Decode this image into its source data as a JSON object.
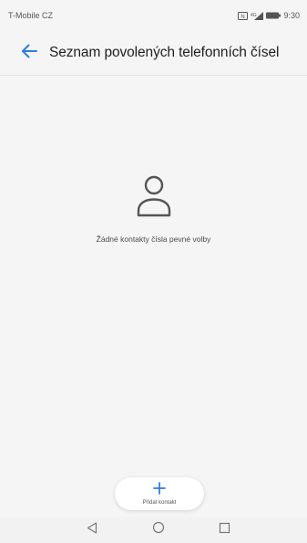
{
  "status_bar": {
    "carrier": "T-Mobile CZ",
    "time": "9:30",
    "icons": [
      "nfc-icon",
      "signal-icon",
      "battery-icon"
    ]
  },
  "app_bar": {
    "back_icon": "back-arrow-icon",
    "title": "Seznam povolených telefonních čísel"
  },
  "empty_state": {
    "icon": "person-icon",
    "message": "Žádné kontakty čísla pevné volby"
  },
  "add_contact": {
    "icon": "plus-icon",
    "label": "Přidat kontakt"
  },
  "nav_bar": {
    "buttons": [
      "back-triangle-icon",
      "home-circle-icon",
      "recents-square-icon"
    ]
  },
  "colors": {
    "accent": "#2f7de0",
    "background": "#f5f5f5",
    "text_primary": "#1f1f1f",
    "icon_gray": "#555555"
  }
}
